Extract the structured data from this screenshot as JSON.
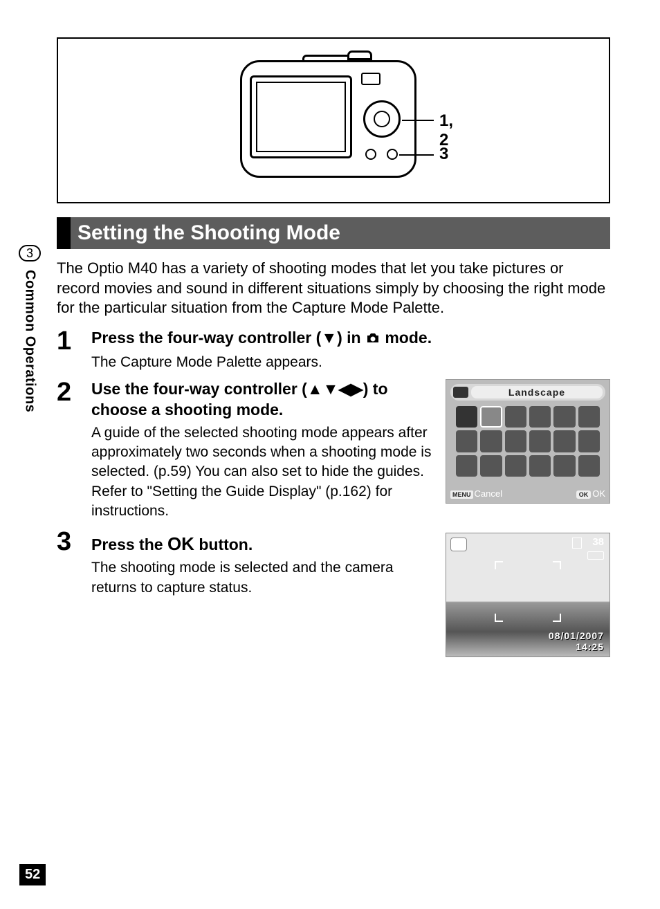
{
  "page_number": "52",
  "side_tab": {
    "number": "3",
    "label": "Common Operations"
  },
  "diagram": {
    "callout_1": "1, 2",
    "callout_2": "3"
  },
  "heading": "Setting the Shooting Mode",
  "intro": "The Optio M40 has a variety of shooting modes that let you take pictures or record movies and sound in different situations simply by choosing the right mode for the particular situation from the Capture Mode Palette.",
  "steps": {
    "s1": {
      "num": "1",
      "title_a": "Press the four-way controller (",
      "title_b": ") in ",
      "title_c": " mode.",
      "desc": "The Capture Mode Palette appears."
    },
    "s2": {
      "num": "2",
      "title": "Use the four-way controller (▲▼◀▶) to choose a shooting mode.",
      "desc": "A guide of the selected shooting mode appears after approximately two seconds when a shooting mode is selected. (p.59) You can also set to hide the guides. Refer to \"Setting the Guide Display\" (p.162) for instructions."
    },
    "s3": {
      "num": "3",
      "title_a": "Press the ",
      "title_ok": "OK",
      "title_b": " button.",
      "desc": "The shooting mode is selected and the camera returns to capture status."
    }
  },
  "palette": {
    "title": "Landscape",
    "menu_label": "MENU",
    "cancel": "Cancel",
    "ok_label": "OK",
    "ok": "OK"
  },
  "capture": {
    "count": "38",
    "date": "08/01/2007",
    "time": "14:25"
  }
}
